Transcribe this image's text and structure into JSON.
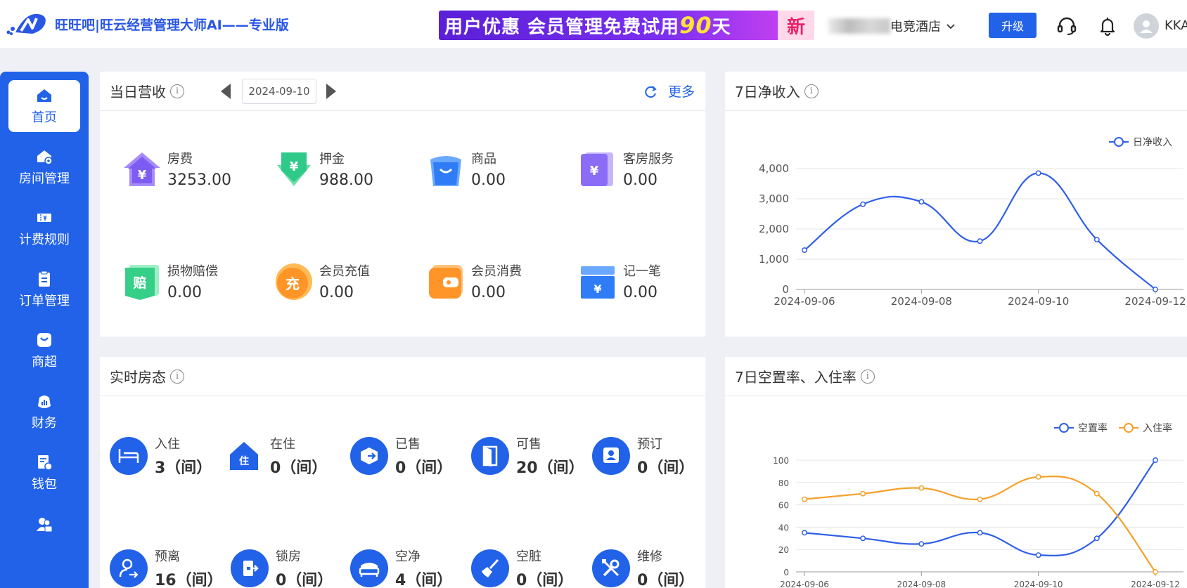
{
  "header": {
    "brand": "旺旺吧|旺云经营管理大师AI——专业版",
    "promo_text": "用户优惠  会员管理免费试用",
    "promo_days": "90",
    "promo_unit": "天",
    "promo_tag": "新",
    "hotel_name": "电竞酒店",
    "upgrade_label": "升级",
    "user_name": "KKA"
  },
  "sidebar": {
    "items": [
      {
        "label": "首页",
        "icon": "home-icon"
      },
      {
        "label": "房间管理",
        "icon": "house-gear-icon"
      },
      {
        "label": "计费规则",
        "icon": "billing-icon"
      },
      {
        "label": "订单管理",
        "icon": "clipboard-icon"
      },
      {
        "label": "商超",
        "icon": "shop-icon"
      },
      {
        "label": "财务",
        "icon": "finance-icon"
      },
      {
        "label": "钱包",
        "icon": "wallet-icon"
      },
      {
        "label": "",
        "icon": "members-icon"
      }
    ]
  },
  "revenue": {
    "title": "当日营收",
    "date": "2024-09-10",
    "more_label": "更多",
    "items": [
      {
        "label": "房费",
        "value": "3253.00"
      },
      {
        "label": "押金",
        "value": "988.00"
      },
      {
        "label": "商品",
        "value": "0.00"
      },
      {
        "label": "客房服务",
        "value": "0.00"
      },
      {
        "label": "损物赔偿",
        "value": "0.00"
      },
      {
        "label": "会员充值",
        "value": "0.00"
      },
      {
        "label": "会员消费",
        "value": "0.00"
      },
      {
        "label": "记一笔",
        "value": "0.00"
      }
    ],
    "icon_glyphs": {
      "room": "¥",
      "deposit": "¥",
      "service": "¥",
      "damage": "赔",
      "recharge": "充",
      "note": "¥"
    }
  },
  "room_status": {
    "title": "实时房态",
    "glyph_zhu": "住",
    "items": [
      {
        "label": "入住",
        "value": "3（间）"
      },
      {
        "label": "在住",
        "value": "0（间）"
      },
      {
        "label": "已售",
        "value": "0（间）"
      },
      {
        "label": "可售",
        "value": "20（间）"
      },
      {
        "label": "预订",
        "value": "0（间）"
      },
      {
        "label": "预离",
        "value": "16（间）"
      },
      {
        "label": "锁房",
        "value": "0（间）"
      },
      {
        "label": "空净",
        "value": "4（间）"
      },
      {
        "label": "空脏",
        "value": "0（间）"
      },
      {
        "label": "维修",
        "value": "0（间）"
      }
    ]
  },
  "chart_data": [
    {
      "type": "line",
      "title": "7日净收入",
      "x": [
        "2024-09-06",
        "2024-09-07",
        "2024-09-08",
        "2024-09-09",
        "2024-09-10",
        "2024-09-11",
        "2024-09-12"
      ],
      "x_tick_labels": [
        "2024-09-06",
        "2024-09-08",
        "2024-09-10",
        "2024-09-12"
      ],
      "series": [
        {
          "name": "日净收入",
          "values": [
            1300,
            2820,
            2900,
            1600,
            3850,
            1650,
            0
          ],
          "color": "#2f5fe8"
        }
      ],
      "ylim": [
        0,
        4000
      ],
      "y_ticks": [
        "0",
        "1,000",
        "2,000",
        "3,000",
        "4,000"
      ],
      "y_tick_values": [
        0,
        1000,
        2000,
        3000,
        4000
      ],
      "grid": true,
      "legend": "top-right",
      "smooth": true
    },
    {
      "type": "line",
      "title": "7日空置率、入住率",
      "x": [
        "2024-09-06",
        "2024-09-07",
        "2024-09-08",
        "2024-09-09",
        "2024-09-10",
        "2024-09-11",
        "2024-09-12"
      ],
      "x_tick_labels": [
        "2024-09-06",
        "2024-09-08",
        "2024-09-10",
        "2024-09-12"
      ],
      "series": [
        {
          "name": "空置率",
          "values": [
            35,
            30,
            25,
            35,
            15,
            30,
            100
          ],
          "color": "#2f5fe8"
        },
        {
          "name": "入住率",
          "values": [
            65,
            70,
            75,
            65,
            85,
            70,
            0
          ],
          "color": "#f5a02a"
        }
      ],
      "ylim": [
        0,
        100
      ],
      "y_ticks": [
        "0",
        "20",
        "40",
        "60",
        "80",
        "100"
      ],
      "y_tick_values": [
        0,
        20,
        40,
        60,
        80,
        100
      ],
      "grid": true,
      "legend": "top-right",
      "smooth": true
    }
  ]
}
